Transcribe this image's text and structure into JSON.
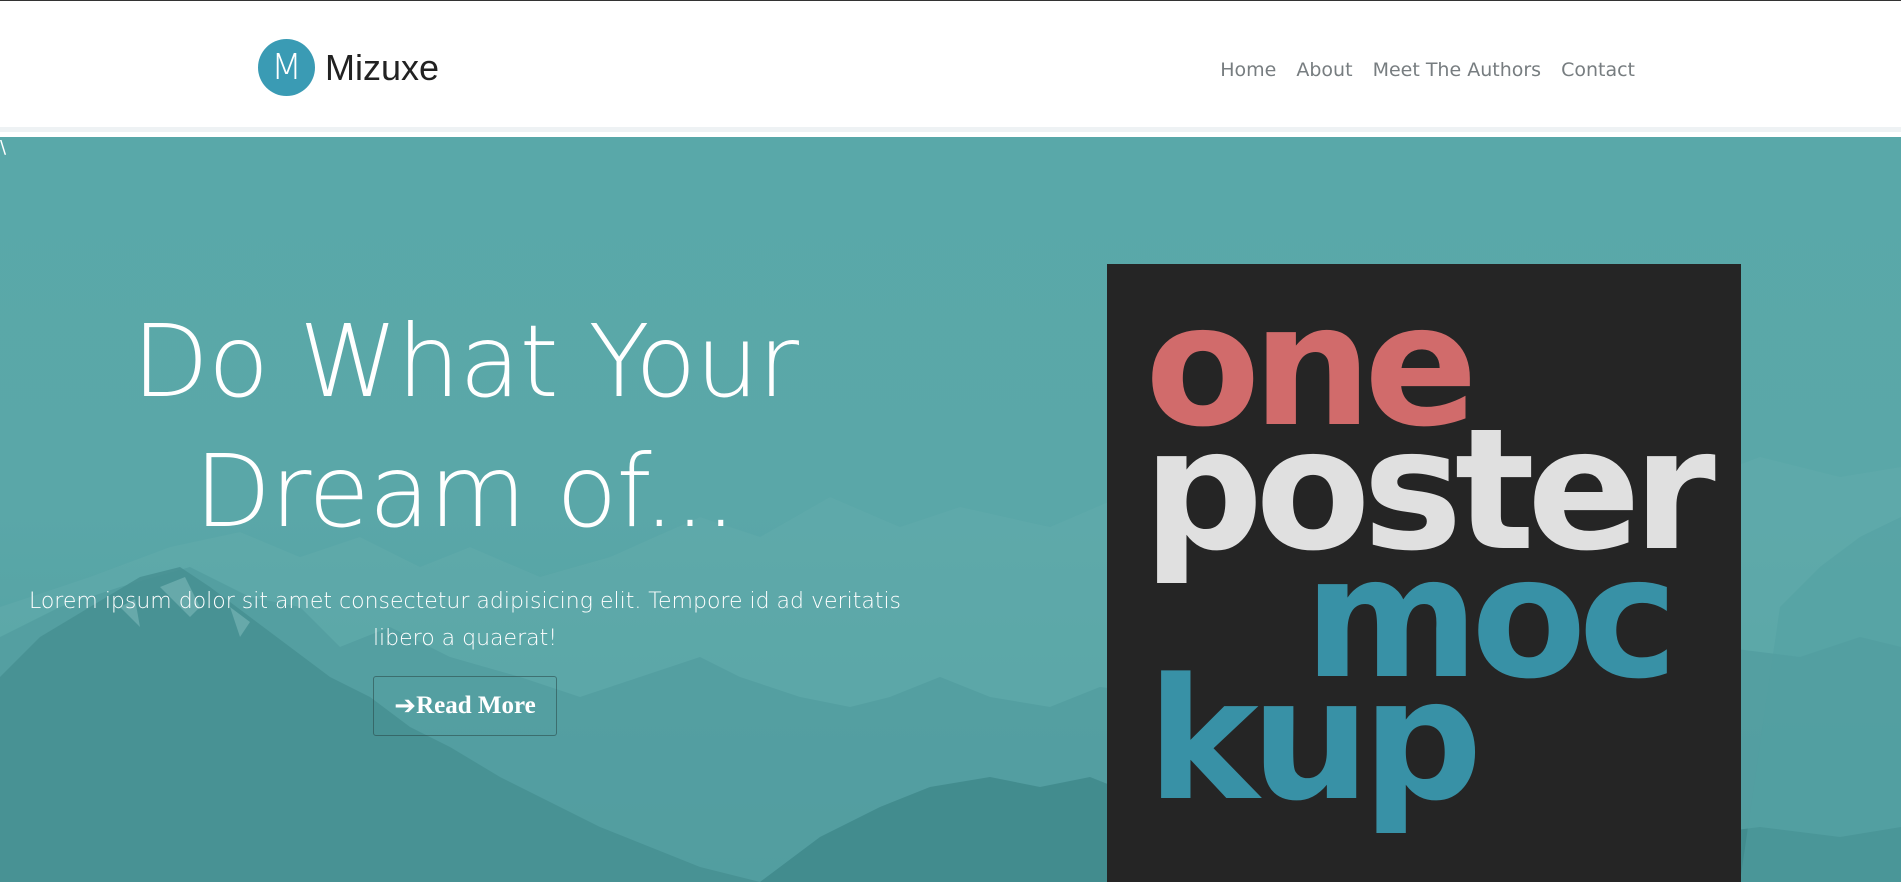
{
  "nav": {
    "logo_letter": "M",
    "brand_name": "Mizuxe",
    "links": [
      {
        "label": "Home"
      },
      {
        "label": "About"
      },
      {
        "label": "Meet The Authors"
      },
      {
        "label": "Contact"
      }
    ]
  },
  "hero": {
    "stray_char": "\\",
    "title_line1": "Do What Your",
    "title_line2": "Dream of...",
    "description": "Lorem ipsum dolor sit amet consectetur adipisicing elit. Tempore id ad veritatis libero a quaerat!",
    "button_label": "Read More",
    "button_icon": "arrow-right-icon"
  },
  "poster": {
    "word1": "one",
    "word2": "poster",
    "word3": "moc",
    "word4": "kup"
  },
  "colors": {
    "brand": "#3a9bb4",
    "hero_bg": "#59a8a9",
    "poster_bg": "#252525",
    "poster_red": "#d16b6b",
    "poster_light": "#e0e0e0",
    "poster_teal": "#3891a6"
  }
}
